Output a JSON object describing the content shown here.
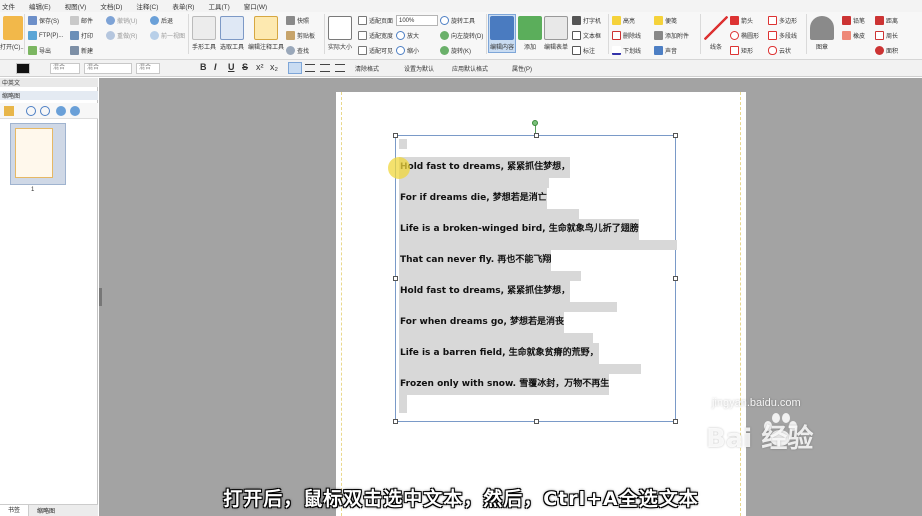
{
  "menu": [
    "文件",
    "编辑(E)",
    "视图(V)",
    "文档(D)",
    "注释(C)",
    "表单(R)",
    "工具(T)",
    "窗口(W)"
  ],
  "ribbon": {
    "open": "打开(C)...",
    "save": "保存(S)",
    "mail": "邮件",
    "undo": "撤销(U)",
    "back": "后退",
    "ftp": "FTP(P)...",
    "print": "打印",
    "redo": "重做(R)",
    "forward": "前一视图",
    "export": "导出",
    "new": "新建",
    "hand_tool": "手形工具",
    "select_tool": "选取工具",
    "edit_tool": "编辑注释工具",
    "snapshot": "快照",
    "clipboard": "剪贴板",
    "find": "查找",
    "actual_size": "实际大小",
    "fit_page": "适配页面",
    "fit_width": "适配宽度",
    "fit_visible": "适配可见",
    "zoom_value": "100%",
    "zoom_in": "放大",
    "zoom_out": "缩小",
    "rotate": "旋转工具",
    "rotate_left": "向左旋转(D)",
    "rotate_right": "旋转(K)",
    "edit_content": "编辑内容",
    "add": "添加",
    "edit_form": "编辑表单",
    "typewriter": "打字机",
    "textbox": "文本框",
    "callout": "标注",
    "highlight": "高亮",
    "strikeout": "删除线",
    "underline": "下划线",
    "note": "便笺",
    "attach": "添加附件",
    "sound": "声音",
    "line": "线条",
    "arrow": "箭头",
    "oval": "椭圆形",
    "rect": "矩形",
    "polygon": "多边形",
    "polyline": "多段线",
    "cloud": "云状",
    "stamp": "图章",
    "pencil": "铅笔",
    "eraser": "橡皮",
    "dist": "距离",
    "perimeter": "周长",
    "area": "面积"
  },
  "format_bar": {
    "font": "混合",
    "size": "混合",
    "style": "混合",
    "bold": "B",
    "italic": "I",
    "underline": "U",
    "strike": "S",
    "superscript": "x²",
    "subscript": "x₂",
    "clear_format": "清除格式",
    "set_default": "设置为默认",
    "use_default": "应用默认格式",
    "properties": "属性(P)"
  },
  "left_panel": {
    "tab": "中英文",
    "header": "缩略图",
    "page_number": "1",
    "bottom_tabs": [
      "书签",
      "缩略图"
    ]
  },
  "document": {
    "lines": [
      "Hold fast to dreams, 紧紧抓住梦想，",
      "For if dreams die, 梦想若是消亡",
      "Life is a broken-winged bird, 生命就象鸟儿折了翅膀",
      "That can never fly. 再也不能飞翔",
      "Hold fast to dreams, 紧紧抓住梦想，",
      "For when dreams go, 梦想若是消丧",
      "Life is a barren field, 生命就象贫瘠的荒野，",
      "Frozen only with snow. 雪覆冰封，万物不再生"
    ]
  },
  "subtitle": "打开后，鼠标双击选中文本，然后，Ctrl+A全选文本",
  "watermark": {
    "text": "Bai 经验",
    "url": "jingyan.baidu.com"
  }
}
